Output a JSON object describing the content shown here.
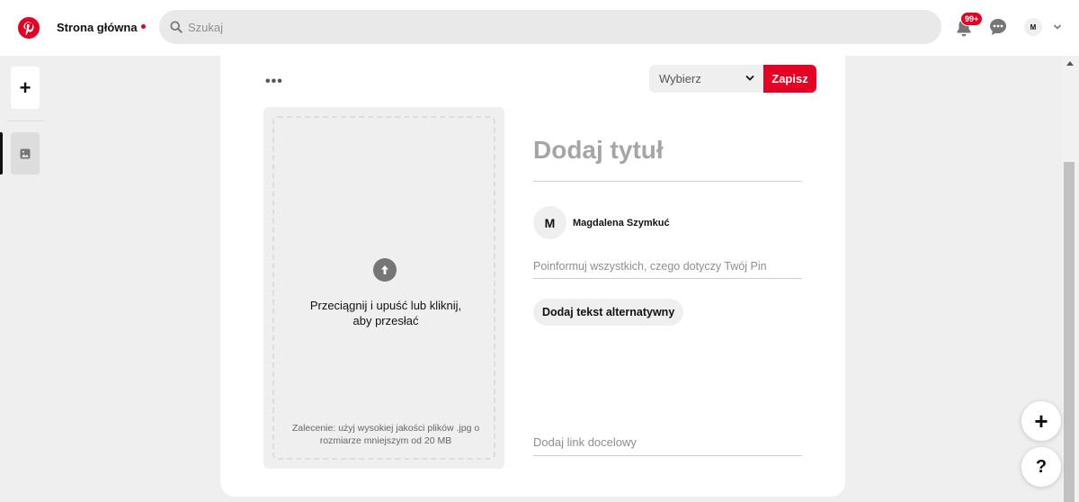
{
  "header": {
    "home_label": "Strona główna",
    "search_placeholder": "Szukaj",
    "notifications_badge": "99+",
    "account_initial": "M"
  },
  "rail": {
    "add_label": "+"
  },
  "card": {
    "more_label": "•••",
    "board_select": "Wybierz",
    "save_label": "Zapisz",
    "upload_text_line1": "Przeciągnij i upuść lub kliknij,",
    "upload_text_line2": "aby przesłać",
    "upload_recommendation_line1": "Zalecenie: użyj wysokiej jakości plików .jpg o",
    "upload_recommendation_line2": "rozmiarze mniejszym od 20 MB",
    "title_placeholder": "Dodaj tytuł",
    "user_initial": "M",
    "user_name": "Magdalena Szymkuć",
    "description_placeholder": "Poinformuj wszystkich, czego dotyczy Twój Pin",
    "alt_text_button": "Dodaj tekst alternatywny",
    "link_placeholder": "Dodaj link docelowy"
  },
  "floating": {
    "add_label": "+",
    "help_label": "?"
  },
  "colors": {
    "brand": "#e60023",
    "background": "#efefef"
  }
}
